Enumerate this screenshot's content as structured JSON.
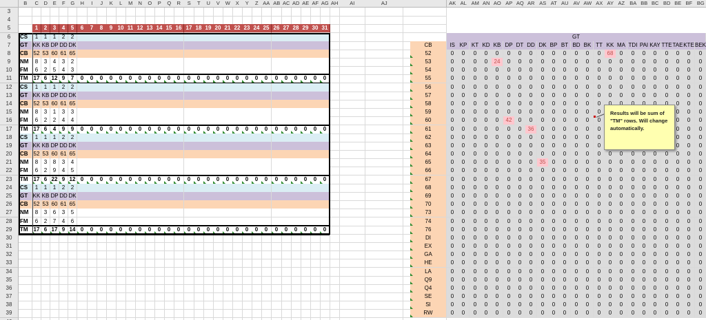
{
  "column_headers": [
    "B",
    "C",
    "D",
    "E",
    "F",
    "G",
    "H",
    "I",
    "J",
    "K",
    "L",
    "M",
    "N",
    "O",
    "P",
    "Q",
    "R",
    "S",
    "T",
    "U",
    "V",
    "W",
    "X",
    "Y",
    "Z",
    "AA",
    "AB",
    "AC",
    "AD",
    "AE",
    "AF",
    "AG",
    "AH",
    "AI",
    "AJ",
    "AK",
    "AL",
    "AM",
    "AN",
    "AO",
    "AP",
    "AQ",
    "AR",
    "AS",
    "AT",
    "AU",
    "AV",
    "AW",
    "AX",
    "AY",
    "AZ",
    "BA",
    "BB",
    "BC",
    "BD",
    "BE",
    "BF",
    "BG"
  ],
  "row_numbers": [
    "3",
    "4",
    "5",
    "6",
    "7",
    "8",
    "9",
    "10",
    "11",
    "12",
    "13",
    "14",
    "15",
    "16",
    "17",
    "18",
    "19",
    "20",
    "21",
    "22",
    "23",
    "24",
    "25",
    "26",
    "27",
    "28",
    "29",
    "30",
    "31",
    "32",
    "33",
    "34",
    "35",
    "36",
    "37",
    "38",
    "39",
    "40"
  ],
  "day_numbers": [
    "1",
    "2",
    "3",
    "4",
    "5",
    "6",
    "7",
    "8",
    "9",
    "10",
    "11",
    "12",
    "13",
    "14",
    "15",
    "16",
    "17",
    "18",
    "19",
    "20",
    "21",
    "22",
    "23",
    "24",
    "25",
    "26",
    "27",
    "28",
    "29",
    "30",
    "31"
  ],
  "blocks": [
    {
      "rows": [
        {
          "label": "CS",
          "type": "cs",
          "values": [
            "1",
            "1",
            "1",
            "2",
            "2"
          ]
        },
        {
          "label": "GT",
          "type": "gt",
          "values": [
            "KK",
            "KB",
            "DP",
            "DD",
            "DK"
          ]
        },
        {
          "label": "CB",
          "type": "cb",
          "values": [
            "52",
            "53",
            "60",
            "61",
            "65"
          ]
        },
        {
          "label": "NM",
          "type": "nm",
          "values": [
            "8",
            "3",
            "4",
            "3",
            "2"
          ]
        },
        {
          "label": "FM",
          "type": "fm",
          "values": [
            "6",
            "2",
            "5",
            "4",
            "3"
          ]
        },
        {
          "label": "TM",
          "type": "tm",
          "values": [
            "17",
            "6",
            "12",
            "9",
            "7"
          ]
        }
      ]
    },
    {
      "rows": [
        {
          "label": "CS",
          "type": "cs",
          "values": [
            "1",
            "1",
            "1",
            "2",
            "2"
          ]
        },
        {
          "label": "GT",
          "type": "gt",
          "values": [
            "KK",
            "KB",
            "DP",
            "DD",
            "DK"
          ]
        },
        {
          "label": "CB",
          "type": "cb",
          "values": [
            "52",
            "53",
            "60",
            "61",
            "65"
          ]
        },
        {
          "label": "NM",
          "type": "nm",
          "values": [
            "8",
            "3",
            "1",
            "3",
            "3"
          ]
        },
        {
          "label": "FM",
          "type": "fm",
          "values": [
            "6",
            "2",
            "2",
            "4",
            "4"
          ]
        },
        {
          "label": "TM",
          "type": "tm",
          "values": [
            "17",
            "6",
            "4",
            "9",
            "9"
          ]
        }
      ]
    },
    {
      "rows": [
        {
          "label": "CS",
          "type": "cs",
          "values": [
            "1",
            "1",
            "1",
            "2",
            "2"
          ]
        },
        {
          "label": "GT",
          "type": "gt",
          "values": [
            "KK",
            "KB",
            "DP",
            "DD",
            "DK"
          ]
        },
        {
          "label": "CB",
          "type": "cb",
          "values": [
            "52",
            "53",
            "60",
            "61",
            "65"
          ]
        },
        {
          "label": "NM",
          "type": "nm",
          "values": [
            "8",
            "3",
            "8",
            "3",
            "4"
          ]
        },
        {
          "label": "FM",
          "type": "fm",
          "values": [
            "6",
            "2",
            "9",
            "4",
            "5"
          ]
        },
        {
          "label": "TM",
          "type": "tm",
          "values": [
            "17",
            "6",
            "22",
            "9",
            "12"
          ]
        }
      ]
    },
    {
      "rows": [
        {
          "label": "CS",
          "type": "cs",
          "values": [
            "1",
            "1",
            "1",
            "2",
            "2"
          ]
        },
        {
          "label": "GT",
          "type": "gt",
          "values": [
            "KK",
            "KB",
            "DP",
            "DD",
            "DK"
          ]
        },
        {
          "label": "CB",
          "type": "cb",
          "values": [
            "52",
            "53",
            "60",
            "61",
            "65"
          ]
        },
        {
          "label": "NM",
          "type": "nm",
          "values": [
            "8",
            "3",
            "6",
            "3",
            "5"
          ]
        },
        {
          "label": "FM",
          "type": "fm",
          "values": [
            "6",
            "2",
            "7",
            "4",
            "6"
          ]
        },
        {
          "label": "TM",
          "type": "tm",
          "values": [
            "17",
            "6",
            "17",
            "9",
            "14"
          ]
        }
      ]
    }
  ],
  "tm_fill_value": "0",
  "summary": {
    "corner_label": "CB",
    "gt_header": "GT",
    "gt_columns": [
      "IS",
      "KP",
      "KT",
      "KD",
      "KB",
      "DP",
      "DT",
      "DD",
      "DK",
      "BP",
      "BT",
      "BD",
      "BK",
      "TT",
      "KK",
      "MA",
      "TDI",
      "PAI",
      "KAY",
      "TTE",
      "TAE",
      "KTE",
      "BEK"
    ],
    "cb_rows": [
      "52",
      "53",
      "54",
      "55",
      "56",
      "57",
      "58",
      "59",
      "60",
      "61",
      "62",
      "63",
      "64",
      "65",
      "66",
      "67",
      "68",
      "69",
      "70",
      "73",
      "74",
      "76",
      "DI",
      "EX",
      "GA",
      "HE",
      "LA",
      "Q9",
      "Q4",
      "SE",
      "SI",
      "RW"
    ],
    "default_value": "0",
    "highlights": [
      {
        "cb": "52",
        "gt": "KK",
        "value": "68"
      },
      {
        "cb": "53",
        "gt": "KB",
        "value": "24"
      },
      {
        "cb": "60",
        "gt": "DP",
        "value": "42"
      },
      {
        "cb": "61",
        "gt": "DD",
        "value": "36"
      },
      {
        "cb": "65",
        "gt": "DK",
        "value": "35"
      }
    ]
  },
  "comment": {
    "text": "Results will be sum of \"TM\" rows. Will change automatically."
  },
  "colors": {
    "cs": "#dbeef4",
    "gt": "#ccc0da",
    "cb": "#fcd5b4",
    "nm": "#ffffff",
    "fm": "#ffffff",
    "tm": "#ffffff",
    "day_header": "#c0504d",
    "summary_label": "#fcd5b4",
    "summary_header": "#ccc0da",
    "summary_grid": "#dcdcdc",
    "highlight": "#ffc7ce",
    "highlight_text": "#c0504d"
  }
}
